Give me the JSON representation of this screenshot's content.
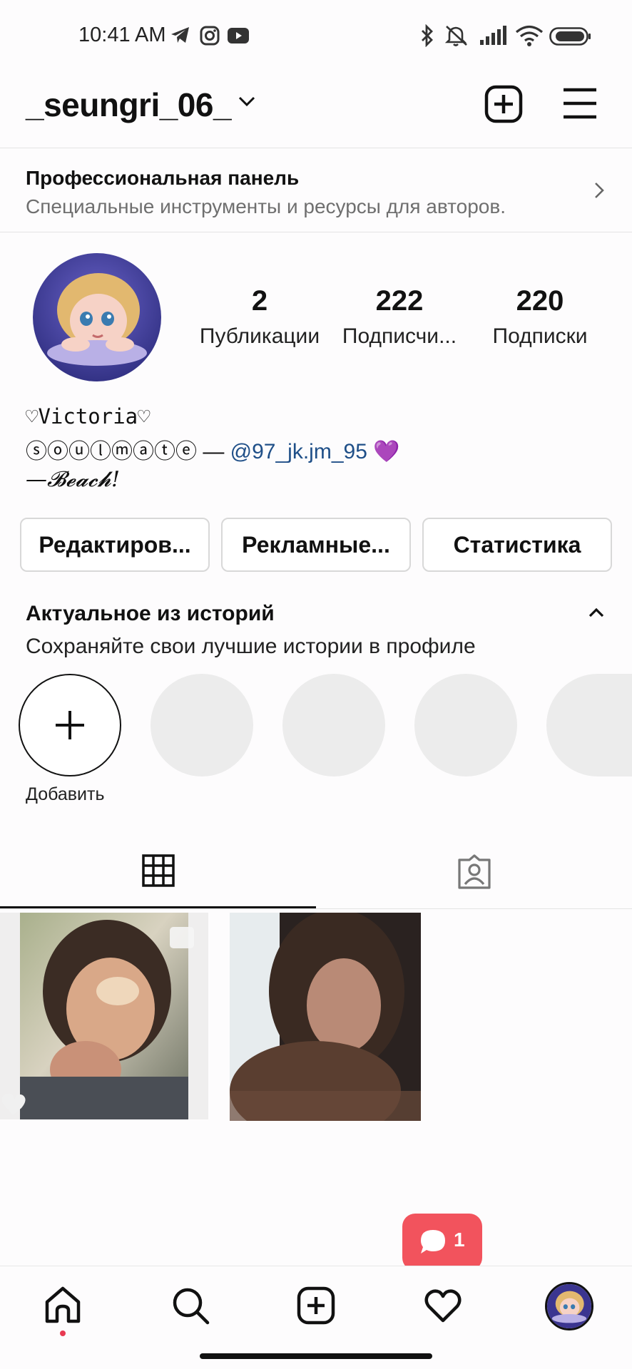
{
  "status_bar": {
    "time": "10:41 AM",
    "left_icons": [
      "telegram-icon",
      "instagram-icon",
      "youtube-icon"
    ],
    "right_icons": [
      "bluetooth-icon",
      "mute-icon",
      "signal-icon",
      "wifi-icon",
      "battery-icon"
    ]
  },
  "header": {
    "username": "_seungri_06_",
    "actions": [
      "new-post-icon",
      "menu-icon"
    ]
  },
  "pro_panel": {
    "title": "Профессиональная панель",
    "subtitle": "Специальные инструменты и ресурсы для авторов."
  },
  "profile": {
    "stats": [
      {
        "value": "2",
        "label": "Публикации"
      },
      {
        "value": "222",
        "label": "Подписчи..."
      },
      {
        "value": "220",
        "label": "Подписки"
      }
    ],
    "bio": {
      "name": "♡Victoria♡",
      "line2_text": "ⓢⓞⓤⓛⓜⓐⓣⓔ — ",
      "line2_link": "@97_jk.jm_95",
      "line2_emoji": "💜",
      "line3": "—𝓑𝓮𝓪𝓬𝓱!"
    },
    "buttons": {
      "edit": "Редактиров...",
      "promo": "Рекламные...",
      "insights": "Статистика"
    }
  },
  "highlights": {
    "title": "Актуальное из историй",
    "subtitle": "Сохраняйте свои лучшие истории в профиле",
    "add_label": "Добавить"
  },
  "tabs": [
    "grid-icon",
    "tagged-icon"
  ],
  "activity": {
    "count": "1"
  },
  "colors": {
    "accent_link": "#1f4f88",
    "notification": "#f2535d",
    "placeholder": "#ececec"
  }
}
